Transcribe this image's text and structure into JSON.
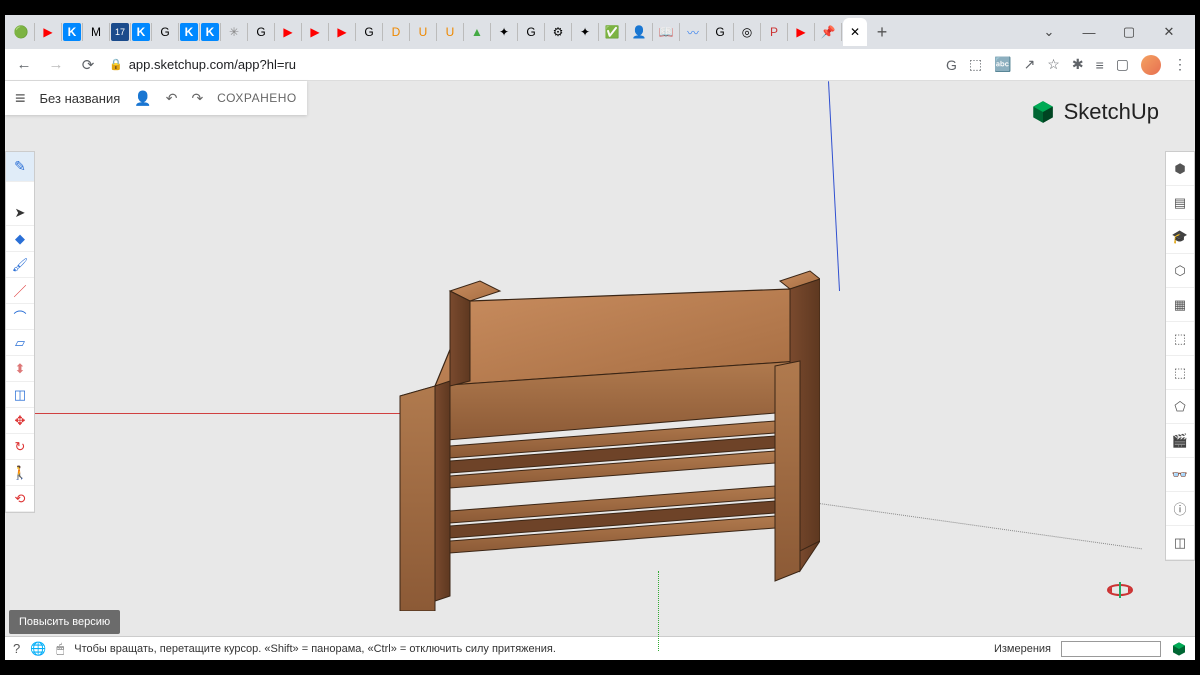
{
  "browser": {
    "url": "app.sketchup.com/app?hl=ru",
    "tabs": [
      "🟢",
      "▶",
      "K",
      "M",
      "17",
      "K",
      "G",
      "K",
      "K",
      "✳",
      "G",
      "▶",
      "▶",
      "▶",
      "G",
      "D",
      "U",
      "U",
      "▲",
      "✦",
      "G",
      "⚙",
      "✦",
      "✅",
      "👤",
      "📖",
      "〰",
      "G",
      "◎",
      "P",
      "▶",
      "📌"
    ],
    "active_tab_close": "✕",
    "back": "←",
    "forward": "→",
    "reload": "⟳",
    "lock": "🔒",
    "win_down": "⌄",
    "win_min": "—",
    "win_max": "▢",
    "win_close": "✕",
    "newtab": "+",
    "addr_icons": [
      "G",
      "⬚",
      "🔤",
      "↗",
      "☆",
      "✱",
      "≡",
      "▢",
      "⋮"
    ]
  },
  "app": {
    "title": "Без названия",
    "saved": "СОХРАНЕНО",
    "brand": "SketchUp",
    "hamburger": "≡",
    "person": "👤",
    "undo": "↶",
    "redo": "↷"
  },
  "left_tools": [
    {
      "name": "sketch-tool",
      "glyph": "✎",
      "active": true,
      "color": "#2a6fd6"
    },
    {
      "name": "select-tool",
      "glyph": "➤",
      "color": "#333"
    },
    {
      "name": "eraser-tool",
      "glyph": "◆",
      "color": "#2a6fd6"
    },
    {
      "name": "paint-tool",
      "glyph": "🖌",
      "color": "#2a6fd6"
    },
    {
      "name": "line-tool",
      "glyph": "／",
      "color": "#d33"
    },
    {
      "name": "arc-tool",
      "glyph": "⌒",
      "color": "#2a6fd6"
    },
    {
      "name": "shape-tool",
      "glyph": "▱",
      "color": "#2a6fd6"
    },
    {
      "name": "pushpull-tool",
      "glyph": "⬍",
      "color": "#d77"
    },
    {
      "name": "offset-tool",
      "glyph": "◫",
      "color": "#2a6fd6"
    },
    {
      "name": "move-tool",
      "glyph": "✥",
      "color": "#d33"
    },
    {
      "name": "rotate-tool",
      "glyph": "↻",
      "color": "#d33"
    },
    {
      "name": "walk-tool",
      "glyph": "🚶",
      "color": "#333"
    },
    {
      "name": "orbit-tool",
      "glyph": "⟲",
      "color": "#d33"
    }
  ],
  "right_panel": [
    {
      "name": "entity-info",
      "glyph": "⬢"
    },
    {
      "name": "instructor",
      "glyph": "▤"
    },
    {
      "name": "learn",
      "glyph": "🎓"
    },
    {
      "name": "components",
      "glyph": "⬡"
    },
    {
      "name": "materials",
      "glyph": "▦"
    },
    {
      "name": "styles",
      "glyph": "⬚"
    },
    {
      "name": "outliner",
      "glyph": "⬚"
    },
    {
      "name": "tags",
      "glyph": "⬠"
    },
    {
      "name": "scenes",
      "glyph": "🎬"
    },
    {
      "name": "display",
      "glyph": "👓"
    },
    {
      "name": "info",
      "glyph": "ⓘ"
    },
    {
      "name": "search",
      "glyph": "◫"
    }
  ],
  "status": {
    "help": "?",
    "lang": "🌐",
    "mouse": "🖱",
    "text": "Чтобы вращать, перетащите курсор. «Shift» = панорама, «Ctrl» = отключить силу притяжения.",
    "measurements_label": "Измерения",
    "measurements_value": ""
  },
  "upgrade_button": "Повысить версию"
}
